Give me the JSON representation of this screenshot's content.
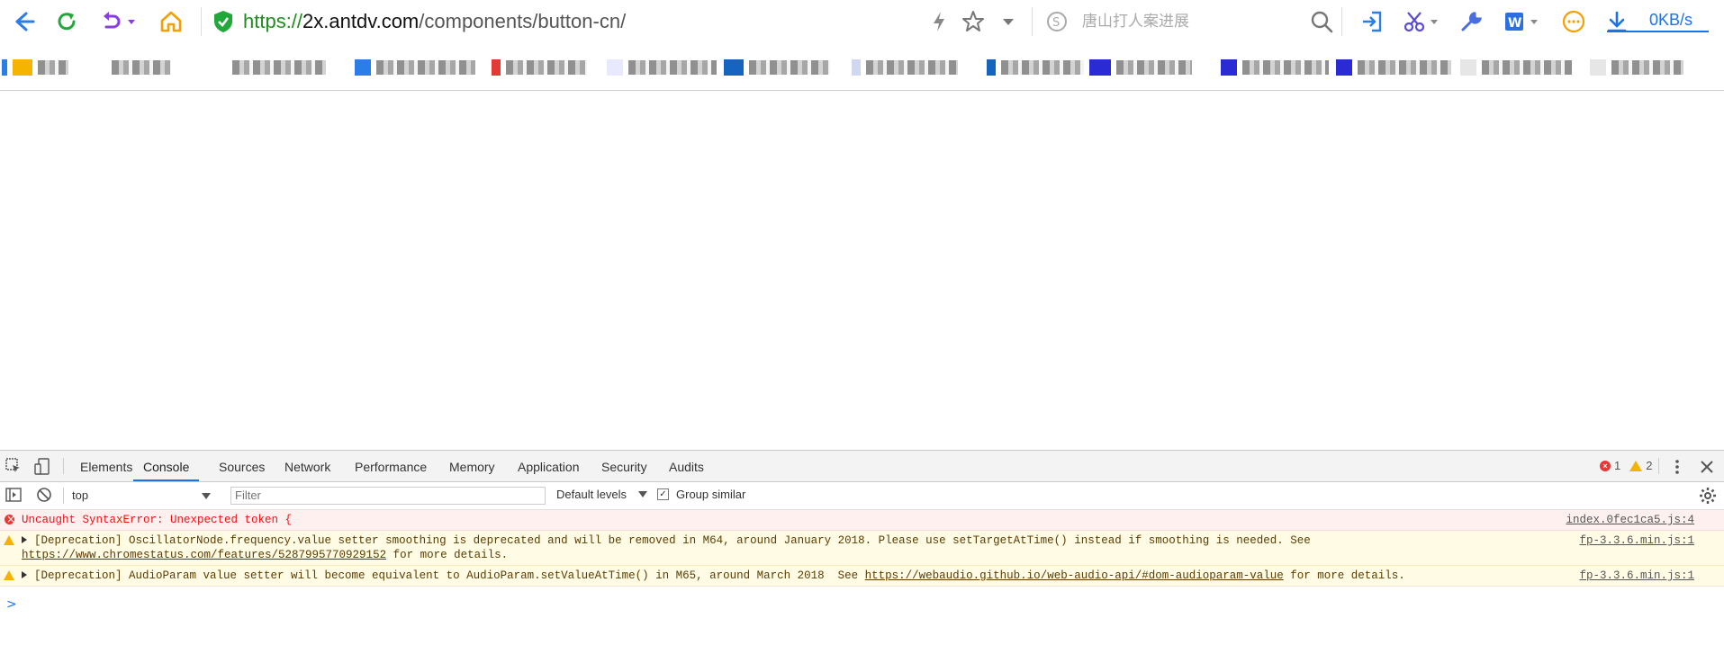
{
  "browser": {
    "url": {
      "proto": "https://",
      "host": "2x.antdv.com",
      "path": "/components/button-cn/"
    },
    "search_placeholder": "唐山打人案进展",
    "download_speed": "0KB/s"
  },
  "devtools": {
    "tabs": [
      "Elements",
      "Console",
      "Sources",
      "Network",
      "Performance",
      "Memory",
      "Application",
      "Security",
      "Audits"
    ],
    "active_tab": "Console",
    "error_count": "1",
    "warning_count": "2",
    "context": "top",
    "filter_placeholder": "Filter",
    "levels_label": "Default levels",
    "group_similar_label": "Group similar",
    "group_similar_checked": true
  },
  "console": {
    "error": {
      "text": "Uncaught SyntaxError: Unexpected token {",
      "source": "index.0fec1ca5.js:4"
    },
    "warning1": {
      "text_before": "[Deprecation] OscillatorNode.frequency.value setter smoothing is deprecated and will be removed in M64, around January 2018. Please use setTargetAtTime() instead if smoothing is needed. See ",
      "link": "https://www.chromestatus.com/features/5287995770929152",
      "text_after": " for more details.",
      "source": "fp-3.3.6.min.js:1"
    },
    "warning2": {
      "text_before": "[Deprecation] AudioParam value setter will become equivalent to AudioParam.setValueAtTime() in M65, around March 2018  See ",
      "link": "https://webaudio.github.io/web-audio-api/#dom-audioparam-value",
      "text_after": " for more details.",
      "source": "fp-3.3.6.min.js:1"
    },
    "prompt": ">"
  },
  "colors": {
    "accent": "#1a73e8",
    "error": "#e53935",
    "warning": "#f2b400"
  }
}
